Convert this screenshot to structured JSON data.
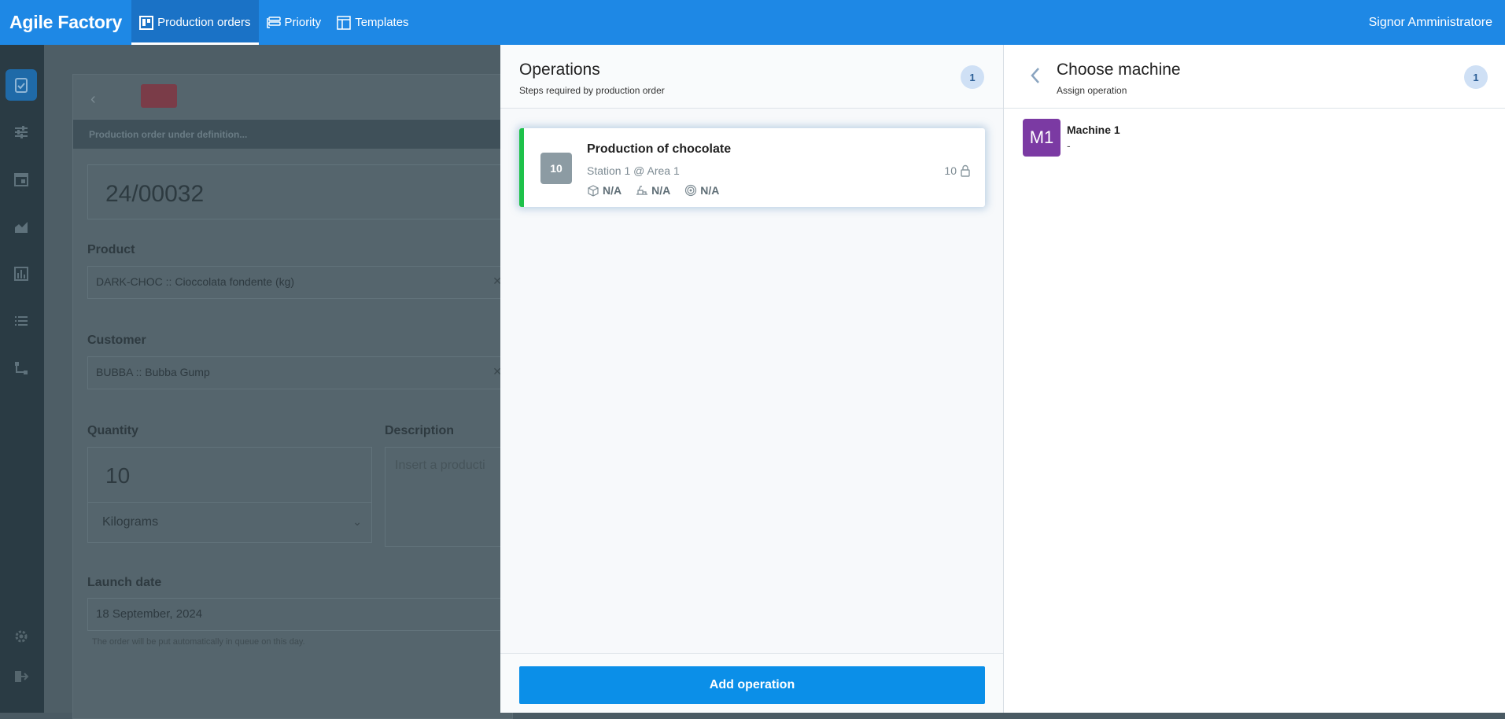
{
  "app": {
    "brand": "Agile Factory",
    "nav": [
      {
        "label": "Production orders",
        "icon": "board-icon"
      },
      {
        "label": "Priority",
        "icon": "priority-list-icon"
      },
      {
        "label": "Templates",
        "icon": "template-icon"
      }
    ],
    "user": "Signor Amministratore"
  },
  "sidebar": {
    "icons": [
      "clipboard-check-icon",
      "sliders-icon",
      "calendar-icon",
      "area-chart-icon",
      "bar-chart-icon",
      "list-icon",
      "workflow-icon",
      "gear-icon",
      "logout-icon"
    ]
  },
  "background_form": {
    "status": "Production order under definition...",
    "order_number": "24/00032",
    "product_label": "Product",
    "product_value": "DARK-CHOC :: Cioccolata fondente (kg)",
    "customer_label": "Customer",
    "customer_value": "BUBBA :: Bubba Gump",
    "quantity_label": "Quantity",
    "quantity_value": "10",
    "unit_value": "Kilograms",
    "description_label": "Description",
    "description_placeholder": "Insert a producti",
    "launch_label": "Launch date",
    "launch_value": "18 September, 2024",
    "launch_hint": "The order will be put automatically in queue on this day."
  },
  "operations": {
    "title": "Operations",
    "subtitle": "Steps required by production order",
    "count": "1",
    "items": [
      {
        "number": "10",
        "title": "Production of chocolate",
        "station": "Station 1 @ Area 1",
        "quantity": "10",
        "metric_material": "N/A",
        "metric_machine": "N/A",
        "metric_target": "N/A",
        "status_color": "#1ec24a"
      }
    ],
    "add_button": "Add operation"
  },
  "machine": {
    "title": "Choose machine",
    "subtitle": "Assign operation",
    "count": "1",
    "items": [
      {
        "avatar": "M1",
        "name": "Machine 1",
        "description": "-",
        "color": "#7b3aa3"
      }
    ]
  }
}
